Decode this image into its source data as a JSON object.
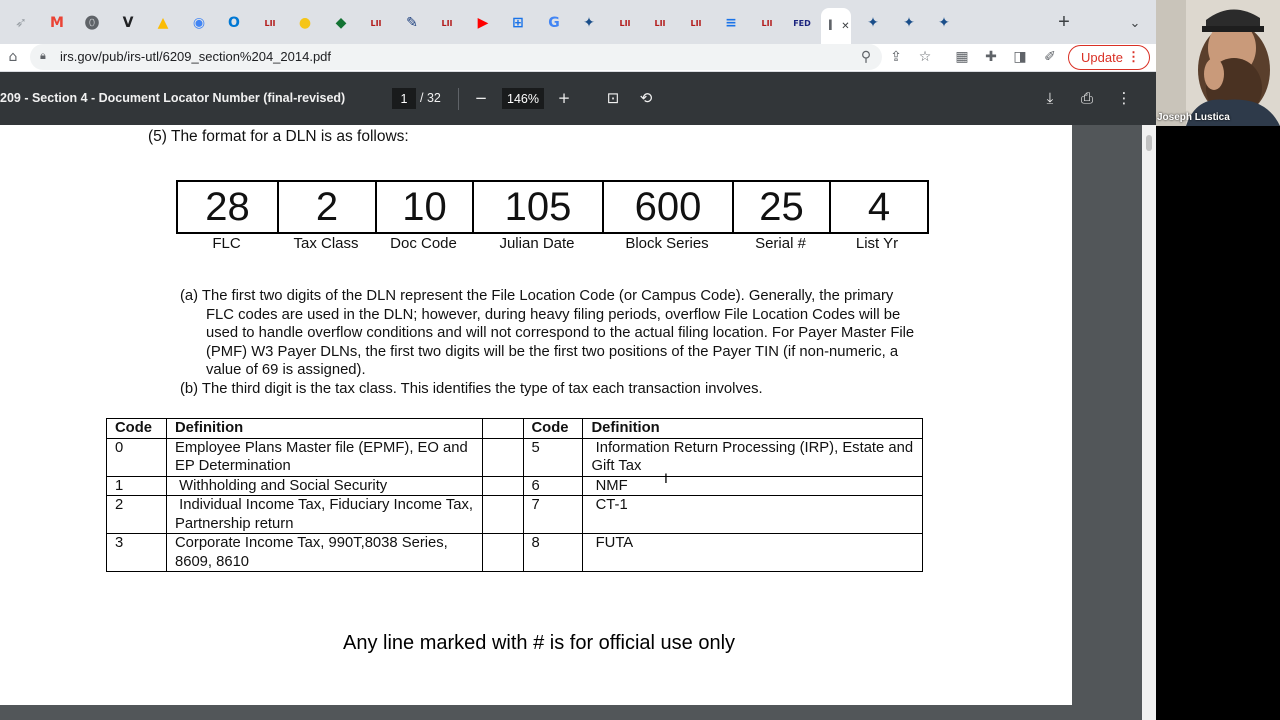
{
  "browser": {
    "tabs": [
      {
        "icon": "feather-icon",
        "glyph": "➶",
        "color": "#9aa0a6"
      },
      {
        "icon": "gmail-icon",
        "glyph": "M",
        "color": "#ea4335"
      },
      {
        "icon": "ring-icon",
        "glyph": "⓿",
        "color": "#5f6368"
      },
      {
        "icon": "v-icon",
        "glyph": "V",
        "color": "#202124"
      },
      {
        "icon": "drive-icon",
        "glyph": "▲",
        "color": "#fbbc04"
      },
      {
        "icon": "chrome-icon",
        "glyph": "◉",
        "color": "#4285f4"
      },
      {
        "icon": "outlook-icon",
        "glyph": "O",
        "color": "#0078d4"
      },
      {
        "icon": "lii-icon",
        "glyph": "LII",
        "color": "#b31b1b"
      },
      {
        "icon": "coin-icon",
        "glyph": "●",
        "color": "#f5c518"
      },
      {
        "icon": "book-icon",
        "glyph": "◆",
        "color": "#137333"
      },
      {
        "icon": "lii-icon",
        "glyph": "LII",
        "color": "#b31b1b"
      },
      {
        "icon": "edit-icon",
        "glyph": "✎",
        "color": "#1a3d7c"
      },
      {
        "icon": "lii-icon",
        "glyph": "LII",
        "color": "#b31b1b"
      },
      {
        "icon": "youtube-icon",
        "glyph": "▶",
        "color": "#ff0000"
      },
      {
        "icon": "map-icon",
        "glyph": "⊞",
        "color": "#1a73e8"
      },
      {
        "icon": "google-icon",
        "glyph": "G",
        "color": "#4285f4"
      },
      {
        "icon": "irs-icon",
        "glyph": "✦",
        "color": "#1a4e8a"
      },
      {
        "icon": "lii-icon",
        "glyph": "LII",
        "color": "#b31b1b"
      },
      {
        "icon": "lii-icon",
        "glyph": "LII",
        "color": "#b31b1b"
      },
      {
        "icon": "lii-icon",
        "glyph": "LII",
        "color": "#b31b1b"
      },
      {
        "icon": "doc-icon",
        "glyph": "≡",
        "color": "#1a73e8"
      },
      {
        "icon": "lii-icon",
        "glyph": "LII",
        "color": "#b31b1b"
      },
      {
        "icon": "fed-icon",
        "glyph": "FED",
        "color": "#1a237e"
      },
      {
        "icon": "pdf-tab-icon",
        "glyph": "I",
        "color": "#5f6368",
        "active": true
      },
      {
        "icon": "irs-icon",
        "glyph": "✦",
        "color": "#1a4e8a"
      },
      {
        "icon": "irs-icon",
        "glyph": "✦",
        "color": "#1a4e8a"
      },
      {
        "icon": "irs-icon",
        "glyph": "✦",
        "color": "#1a4e8a"
      }
    ],
    "url": "irs.gov/pub/irs-utl/6209_section%204_2014.pdf",
    "update_label": "Update"
  },
  "pdf": {
    "title": "209 - Section 4 - Document Locator Number (final-revised)",
    "page_current": "1",
    "page_total": "/ 32",
    "zoom": "146%"
  },
  "doc": {
    "intro": "(5) The format for a DLN is as follows:",
    "dln_values": [
      "28",
      "2",
      "10",
      "105",
      "600",
      "25",
      "4"
    ],
    "dln_labels": [
      "FLC",
      "Tax Class",
      "Doc Code",
      "Julian Date",
      "Block Series",
      "Serial #",
      "List Yr"
    ],
    "para_a_lines": [
      "(a) The first two digits of the DLN represent the File Location Code (or Campus Code). Generally, the primary",
      "FLC codes are used in the DLN; however, during heavy filing periods, overflow File Location Codes will be",
      "used to handle overflow conditions and will not correspond to the actual filing location. For Payer Master File",
      "(PMF) W3 Payer DLNs, the first two digits will be the first two positions of the Payer TIN (if non-numeric, a",
      "value of 69 is assigned)."
    ],
    "para_b": "(b) The third digit is the tax class. This identifies the type of tax each transaction involves.",
    "table_headers": {
      "code": "Code",
      "definition": "Definition"
    },
    "table_rows": [
      {
        "code1": "0",
        "def1": "Employee Plans Master file (EPMF), EO and EP Determination",
        "code2": "5",
        "def2": " Information Return Processing (IRP), Estate and Gift Tax"
      },
      {
        "code1": "1",
        "def1": " Withholding and Social Security",
        "code2": "6",
        "def2": " NMF"
      },
      {
        "code1": "2",
        "def1": " Individual Income Tax, Fiduciary Income Tax, Partnership return",
        "code2": "7",
        "def2": " CT-1"
      },
      {
        "code1": "3",
        "def1": "Corporate Income Tax, 990T,8038 Series, 8609, 8610",
        "code2": "8",
        "def2": " FUTA"
      }
    ],
    "footer_note": "Any line marked with # is for official use only"
  },
  "webcam": {
    "name": "Joseph Lustica"
  }
}
